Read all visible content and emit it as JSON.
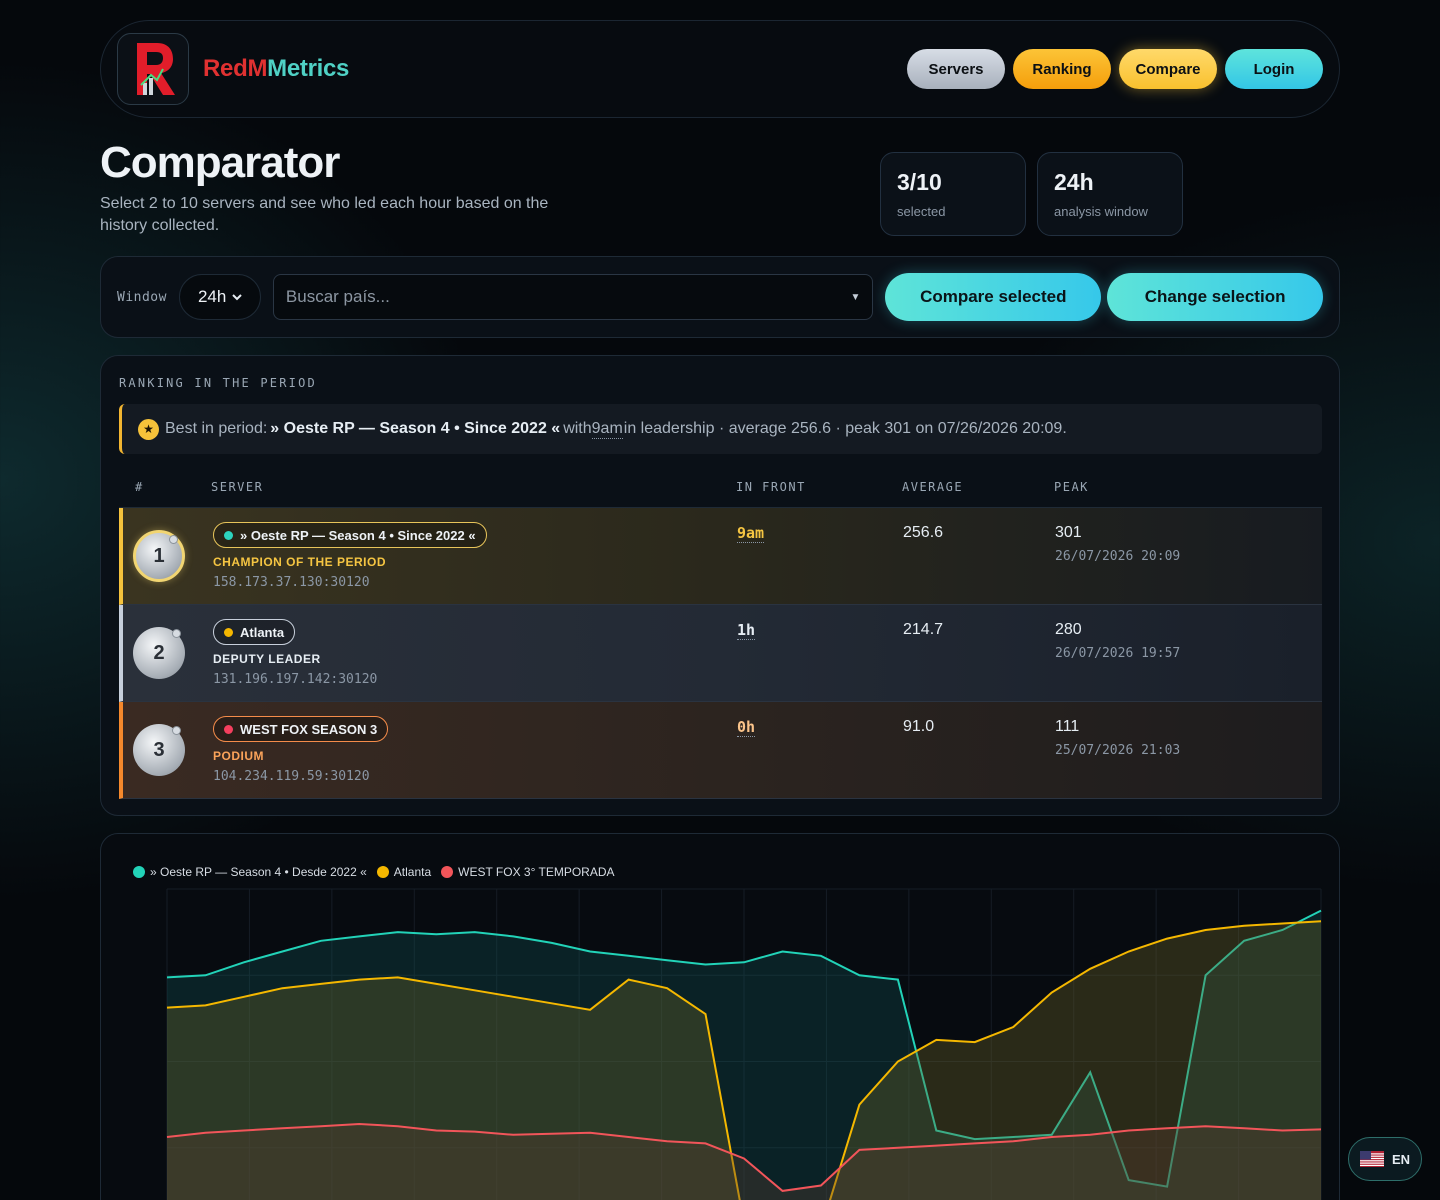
{
  "header": {
    "brand_red": "RedM",
    "brand_teal": "Metrics",
    "nav": {
      "servers": "Servers",
      "ranking": "Ranking",
      "compare": "Compare",
      "login": "Login"
    }
  },
  "page": {
    "title": "Comparator",
    "subtitle": "Select 2 to 10 servers and see who led each hour based on the history collected."
  },
  "stats": [
    {
      "value": "3/10",
      "label": "selected"
    },
    {
      "value": "24h",
      "label": "analysis window"
    }
  ],
  "controls": {
    "window_label": "Window",
    "window_value": "24h",
    "search_placeholder": "Buscar país...",
    "compare_btn": "Compare selected",
    "change_btn": "Change selection"
  },
  "ranking": {
    "section_title": "RANKING IN THE PERIOD",
    "best": {
      "prefix": "Best in period:",
      "server": "» Oeste RP — Season 4 • Since 2022 «",
      "with": "with",
      "hours": "9am",
      "rest": "in leadership · average 256.6 · peak 301 on 07/26/2026 20:09."
    },
    "headers": {
      "rank": "#",
      "server": "SERVER",
      "front": "IN FRONT",
      "average": "AVERAGE",
      "peak": "PEAK"
    },
    "rows": [
      {
        "rank": "1",
        "name": "» Oeste RP — Season 4 • Since 2022 «",
        "dot_color": "#2dd4bf",
        "role": "CHAMPION OF THE PERIOD",
        "role_color": "#f5c542",
        "ip": "158.173.37.130:30120",
        "front": "9am",
        "front_color": "#f5c542",
        "avg": "256.6",
        "peak": "301",
        "peak_date": "26/07/2026 20:09"
      },
      {
        "rank": "2",
        "name": "Atlanta",
        "dot_color": "#f5b700",
        "role": "DEPUTY LEADER",
        "role_color": "#e6edf3",
        "ip": "131.196.197.142:30120",
        "front": "1h",
        "front_color": "#e6edf3",
        "avg": "214.7",
        "peak": "280",
        "peak_date": "26/07/2026 19:57"
      },
      {
        "rank": "3",
        "name": "WEST FOX SEASON 3",
        "dot_color": "#f43f5e",
        "role": "PODIUM",
        "role_color": "#fba35a",
        "ip": "104.234.119.59:30120",
        "front": "0h",
        "front_color": "#fbc48a",
        "avg": "91.0",
        "peak": "111",
        "peak_date": "25/07/2026 21:03"
      }
    ]
  },
  "chart_data": {
    "type": "area",
    "legend": [
      "» Oeste RP — Season 4 • Desde 2022 «",
      "Atlanta",
      "WEST FOX 3° TEMPORADA"
    ],
    "colors": [
      "#22d3b8",
      "#f5b800",
      "#f2555a"
    ],
    "series": [
      {
        "name": "» Oeste RP — Season 4 • Desde 2022 «",
        "values": [
          238,
          240,
          252,
          262,
          272,
          276,
          280,
          278,
          280,
          276,
          270,
          262,
          258,
          254,
          250,
          252,
          262,
          258,
          240,
          236,
          96,
          88,
          90,
          92,
          150,
          50,
          44,
          240,
          272,
          282,
          300
        ]
      },
      {
        "name": "Atlanta",
        "values": [
          210,
          212,
          220,
          228,
          232,
          236,
          238,
          232,
          226,
          220,
          214,
          208,
          236,
          228,
          204,
          10,
          6,
          4,
          120,
          160,
          180,
          178,
          192,
          224,
          246,
          262,
          274,
          282,
          286,
          288,
          290
        ]
      },
      {
        "name": "WEST FOX 3° TEMPORADA",
        "values": [
          90,
          94,
          96,
          98,
          100,
          102,
          100,
          96,
          95,
          92,
          93,
          94,
          90,
          86,
          84,
          70,
          40,
          45,
          78,
          80,
          82,
          84,
          86,
          90,
          92,
          96,
          98,
          100,
          98,
          96,
          97
        ]
      }
    ]
  },
  "lang": {
    "code": "EN"
  }
}
